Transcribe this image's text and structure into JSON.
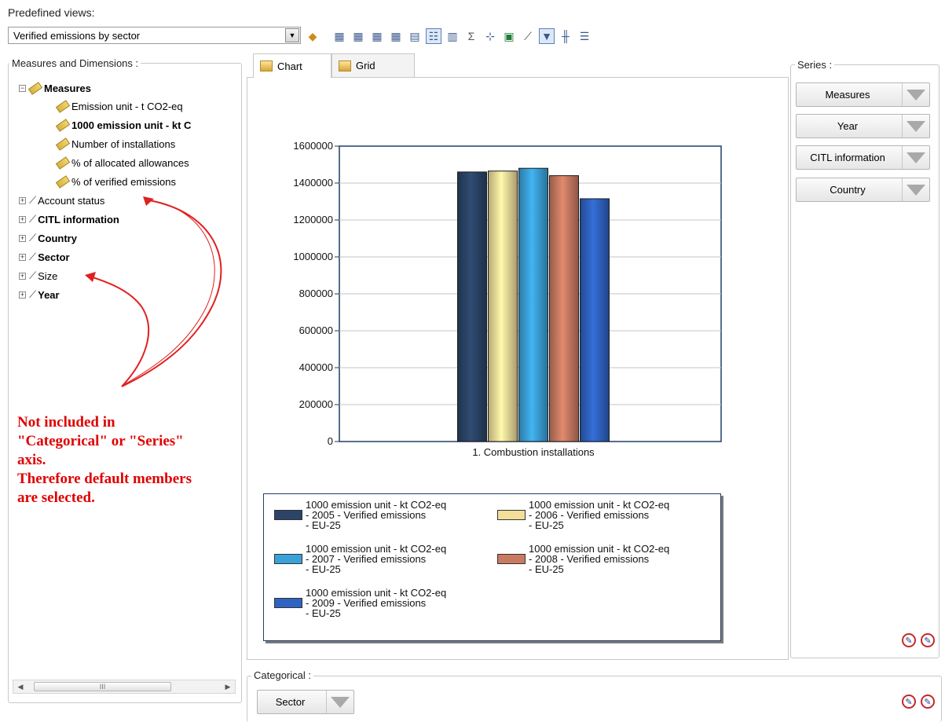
{
  "predefined_views": {
    "label": "Predefined views:",
    "selected": "Verified emissions by sector"
  },
  "toolbar": {
    "icons": [
      "cube-icon",
      "bar-chart-icon",
      "bar-chart-icon",
      "bar-chart-icon",
      "bar-chart-icon",
      "chart-options-icon",
      "grid-icon",
      "chart-wizard-icon",
      "sum-icon",
      "axis-icon",
      "excel-icon",
      "line-axis-icon",
      "filter-icon",
      "columns-icon",
      "rows-icon"
    ]
  },
  "left_panel": {
    "title": "Measures and Dimensions :",
    "measures_label": "Measures",
    "measures": [
      {
        "label": "Emission unit - t CO2-eq",
        "bold": false
      },
      {
        "label": "1000 emission unit - kt C",
        "bold": true
      },
      {
        "label": "Number of installations",
        "bold": false
      },
      {
        "label": "% of allocated allowances",
        "bold": false
      },
      {
        "label": "% of verified emissions",
        "bold": false
      }
    ],
    "dimensions": [
      {
        "label": "Account status",
        "bold": false
      },
      {
        "label": "CITL information",
        "bold": true
      },
      {
        "label": "Country",
        "bold": true
      },
      {
        "label": "Sector",
        "bold": true
      },
      {
        "label": "Size",
        "bold": false
      },
      {
        "label": "Year",
        "bold": true
      }
    ],
    "scroll_thumb": "III"
  },
  "annotation": {
    "line1": "Not included in",
    "line2": "\"Categorical\" or \"Series\"",
    "line3": "axis.",
    "line4": "Therefore default members",
    "line5": "are selected."
  },
  "tabs": [
    {
      "label": "Chart",
      "active": true
    },
    {
      "label": "Grid",
      "active": false
    }
  ],
  "series_panel": {
    "title": "Series :",
    "buttons": [
      "Measures",
      "Year",
      "CITL information",
      "Country"
    ]
  },
  "categorical_panel": {
    "title": "Categorical :",
    "buttons": [
      "Sector"
    ]
  },
  "chart_data": {
    "type": "bar",
    "categories": [
      "1. Combustion installations"
    ],
    "ylim": [
      0,
      1600000
    ],
    "yticks": [
      0,
      200000,
      400000,
      600000,
      800000,
      1000000,
      1200000,
      1400000,
      1600000
    ],
    "grid": true,
    "legend_position": "bottom",
    "series": [
      {
        "name": "1000 emission unit - kt CO2-eq\n- 2005 - Verified emissions\n- EU-25",
        "values": [
          1460000
        ],
        "color": "#2b4467"
      },
      {
        "name": "1000 emission unit - kt CO2-eq\n- 2006 - Verified emissions\n- EU-25",
        "values": [
          1465000
        ],
        "color": "#f3de9a"
      },
      {
        "name": "1000 emission unit - kt CO2-eq\n- 2007 - Verified emissions\n- EU-25",
        "values": [
          1480000
        ],
        "color": "#3aa2d9"
      },
      {
        "name": "1000 emission unit - kt CO2-eq\n- 2008 - Verified emissions\n- EU-25",
        "values": [
          1440000
        ],
        "color": "#c97b62"
      },
      {
        "name": "1000 emission unit - kt CO2-eq\n- 2009 - Verified emissions\n- EU-25",
        "values": [
          1315000
        ],
        "color": "#2f63c2"
      }
    ]
  }
}
